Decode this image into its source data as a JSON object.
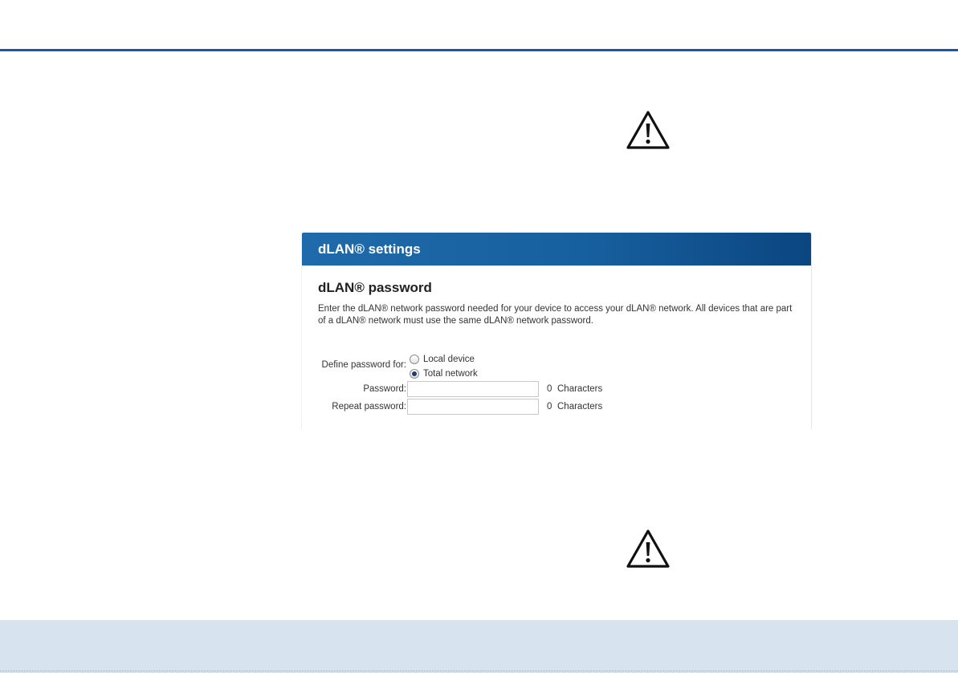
{
  "panel": {
    "header_title": "dLAN® settings",
    "section_title": "dLAN® password",
    "description": "Enter the dLAN® network password needed for your device to access your dLAN® network. All devices that are part of a dLAN® network must use the same dLAN® network password."
  },
  "form": {
    "define_for_label": "Define password for:",
    "options": [
      {
        "label": "Local device",
        "selected": false
      },
      {
        "label": "Total network",
        "selected": true
      }
    ],
    "password_label": "Password:",
    "password_value": "",
    "password_count": "0",
    "repeat_label": "Repeat password:",
    "repeat_value": "",
    "repeat_count": "0",
    "characters_label": "Characters"
  },
  "icons": {
    "top": "warning-icon",
    "bottom": "warning-icon"
  },
  "colors": {
    "header_blue": "#17609f",
    "rule_blue": "#1a55b4",
    "footer_band": "#d7e3ee"
  }
}
